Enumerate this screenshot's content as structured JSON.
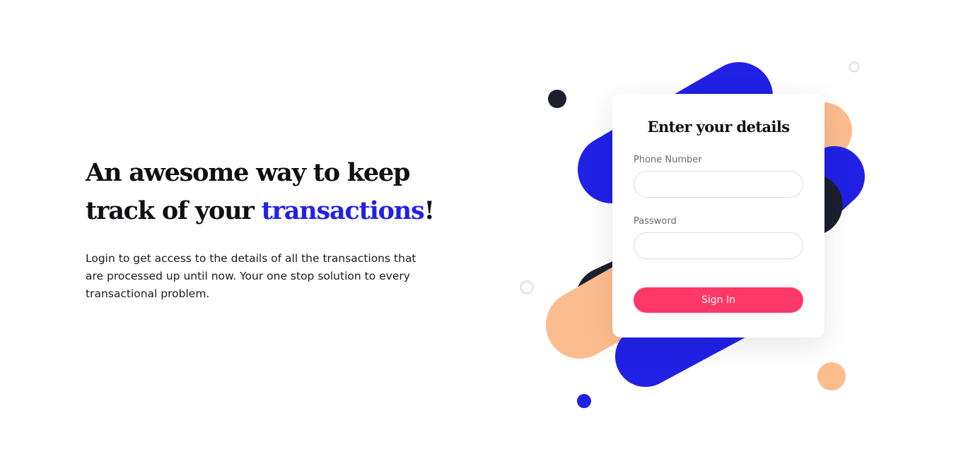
{
  "hero": {
    "title_part1": "An awesome way to keep track of your ",
    "title_accent": "transactions",
    "title_end": "!",
    "description": "Login to get access to the details of all the transactions that are processed up until now. Your one stop solution to every transactional problem."
  },
  "login_card": {
    "title": "Enter your details",
    "phone_label": "Phone Number",
    "phone_value": "",
    "password_label": "Password",
    "password_value": "",
    "submit_label": "Sign In"
  },
  "colors": {
    "accent_blue": "#2121e6",
    "navy": "#1b1f2e",
    "peach": "#fcbd8e",
    "pink_button": "#fe3867"
  }
}
